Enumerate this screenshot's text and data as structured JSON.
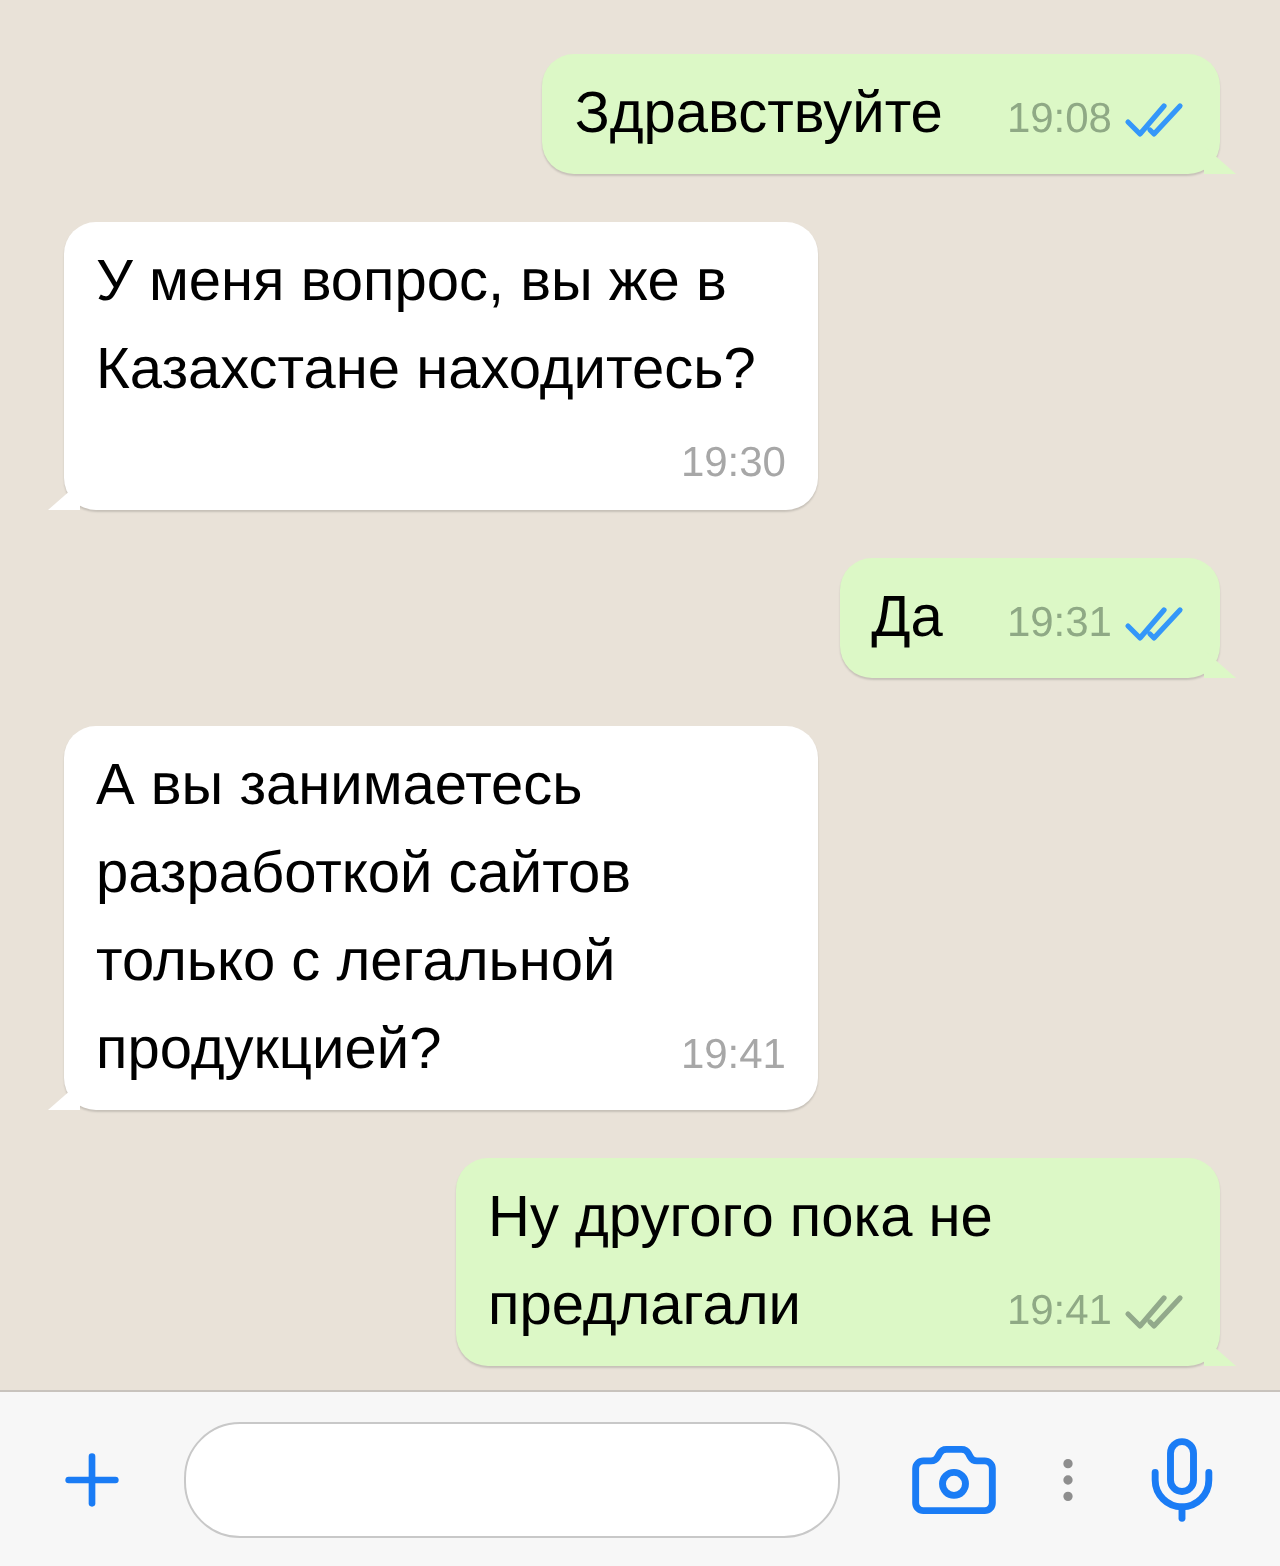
{
  "messages": [
    {
      "kind": "outgoing",
      "text": "Здравствуйте",
      "time": "19:08",
      "read": true
    },
    {
      "kind": "incoming",
      "text": "У меня вопрос, вы же в Казахстане находитесь?",
      "time": "19:30"
    },
    {
      "kind": "outgoing",
      "text": "Да",
      "time": "19:31",
      "read": true
    },
    {
      "kind": "incoming",
      "text": "А вы занимаетесь разработкой сайтов только с легальной продукцией?",
      "time": "19:41"
    },
    {
      "kind": "outgoing",
      "text": "Ну другого пока не предлагали",
      "time": "19:41",
      "read": false
    }
  ]
}
